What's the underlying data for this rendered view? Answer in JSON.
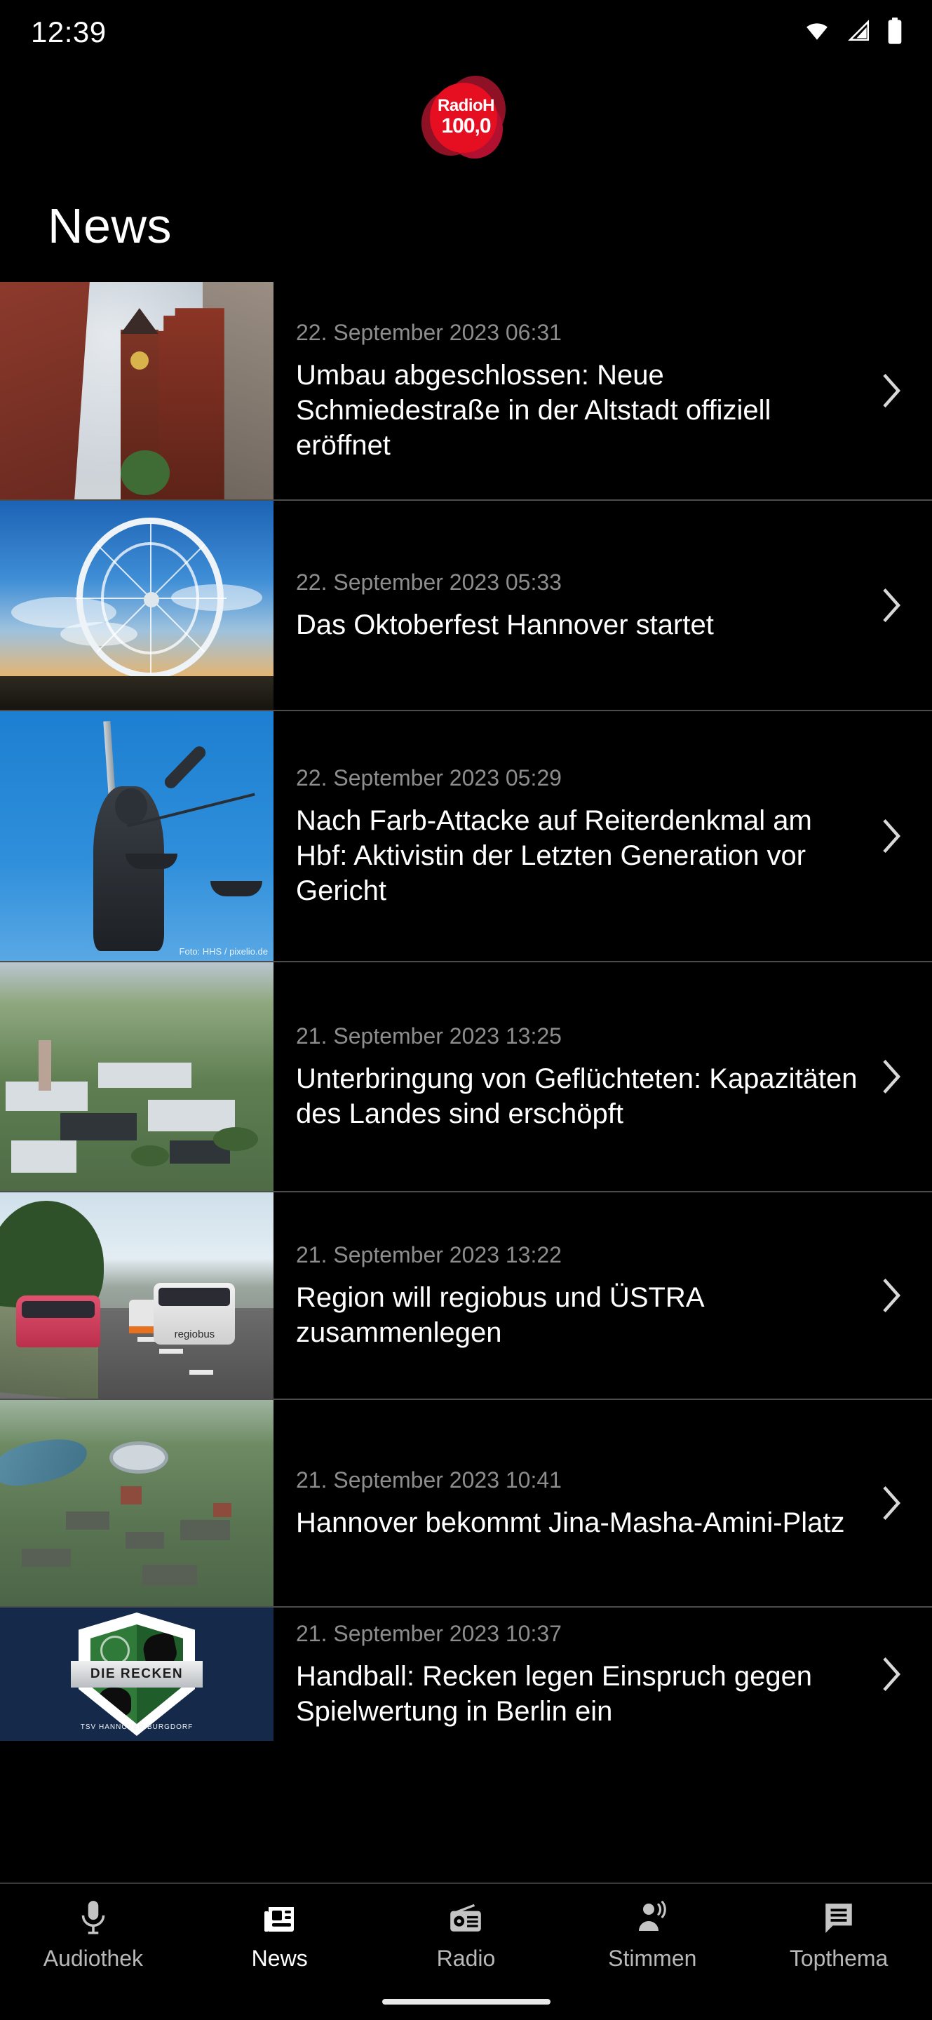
{
  "status_bar": {
    "time": "12:39",
    "icons": [
      "wifi-icon",
      "signal-icon",
      "battery-icon"
    ]
  },
  "header": {
    "logo_line1": "RadioH",
    "logo_line2": "100,0",
    "logo_color": "#e60f21"
  },
  "page": {
    "title": "News"
  },
  "news": {
    "items": [
      {
        "date": "22. September 2023 06:31",
        "title": "Umbau abgeschlossen: Neue Schmiedestraße in der Altstadt offiziell eröffnet",
        "thumb": "old-town-church-photo",
        "chevron": "chevron-right-icon"
      },
      {
        "date": "22. September 2023 05:33",
        "title": "Das Oktoberfest Hannover startet",
        "thumb": "ferris-wheel-sunset-photo",
        "chevron": "chevron-right-icon"
      },
      {
        "date": "22. September 2023 05:29",
        "title": "Nach Farb-Attacke auf Reiterdenkmal am Hbf: Aktivistin der Letzten Generation vor Gericht",
        "thumb": "lady-justice-statue-photo",
        "thumb_credit": "Foto: HHS / pixelio.de",
        "chevron": "chevron-right-icon"
      },
      {
        "date": "21. September 2023 13:25",
        "title": "Unterbringung von Geflüchteten: Kapazitäten des Landes sind erschöpft",
        "thumb": "aerial-exhibition-grounds-photo",
        "chevron": "chevron-right-icon"
      },
      {
        "date": "21. September 2023 13:22",
        "title": "Region will regiobus und ÜSTRA zusammenlegen",
        "thumb": "tram-and-bus-street-photo",
        "thumb_label": "regiobus",
        "chevron": "chevron-right-icon"
      },
      {
        "date": "21. September 2023 10:41",
        "title": "Hannover bekommt Jina-Masha-Amini-Platz",
        "thumb": "aerial-city-hannover-photo",
        "chevron": "chevron-right-icon"
      },
      {
        "date": "21. September 2023 10:37",
        "title": "Handball: Recken legen Einspruch gegen Spielwertung in Berlin ein",
        "thumb": "die-recken-club-logo",
        "thumb_label": "DIE RECKEN",
        "thumb_sublabel": "TSV HANNOVER-BURGDORF",
        "chevron": "chevron-right-icon"
      }
    ]
  },
  "bottom_nav": {
    "active_index": 1,
    "items": [
      {
        "label": "Audiothek",
        "icon": "microphone-icon"
      },
      {
        "label": "News",
        "icon": "newspaper-icon"
      },
      {
        "label": "Radio",
        "icon": "radio-icon"
      },
      {
        "label": "Stimmen",
        "icon": "person-speaking-icon"
      },
      {
        "label": "Topthema",
        "icon": "speech-bubble-icon"
      }
    ]
  }
}
